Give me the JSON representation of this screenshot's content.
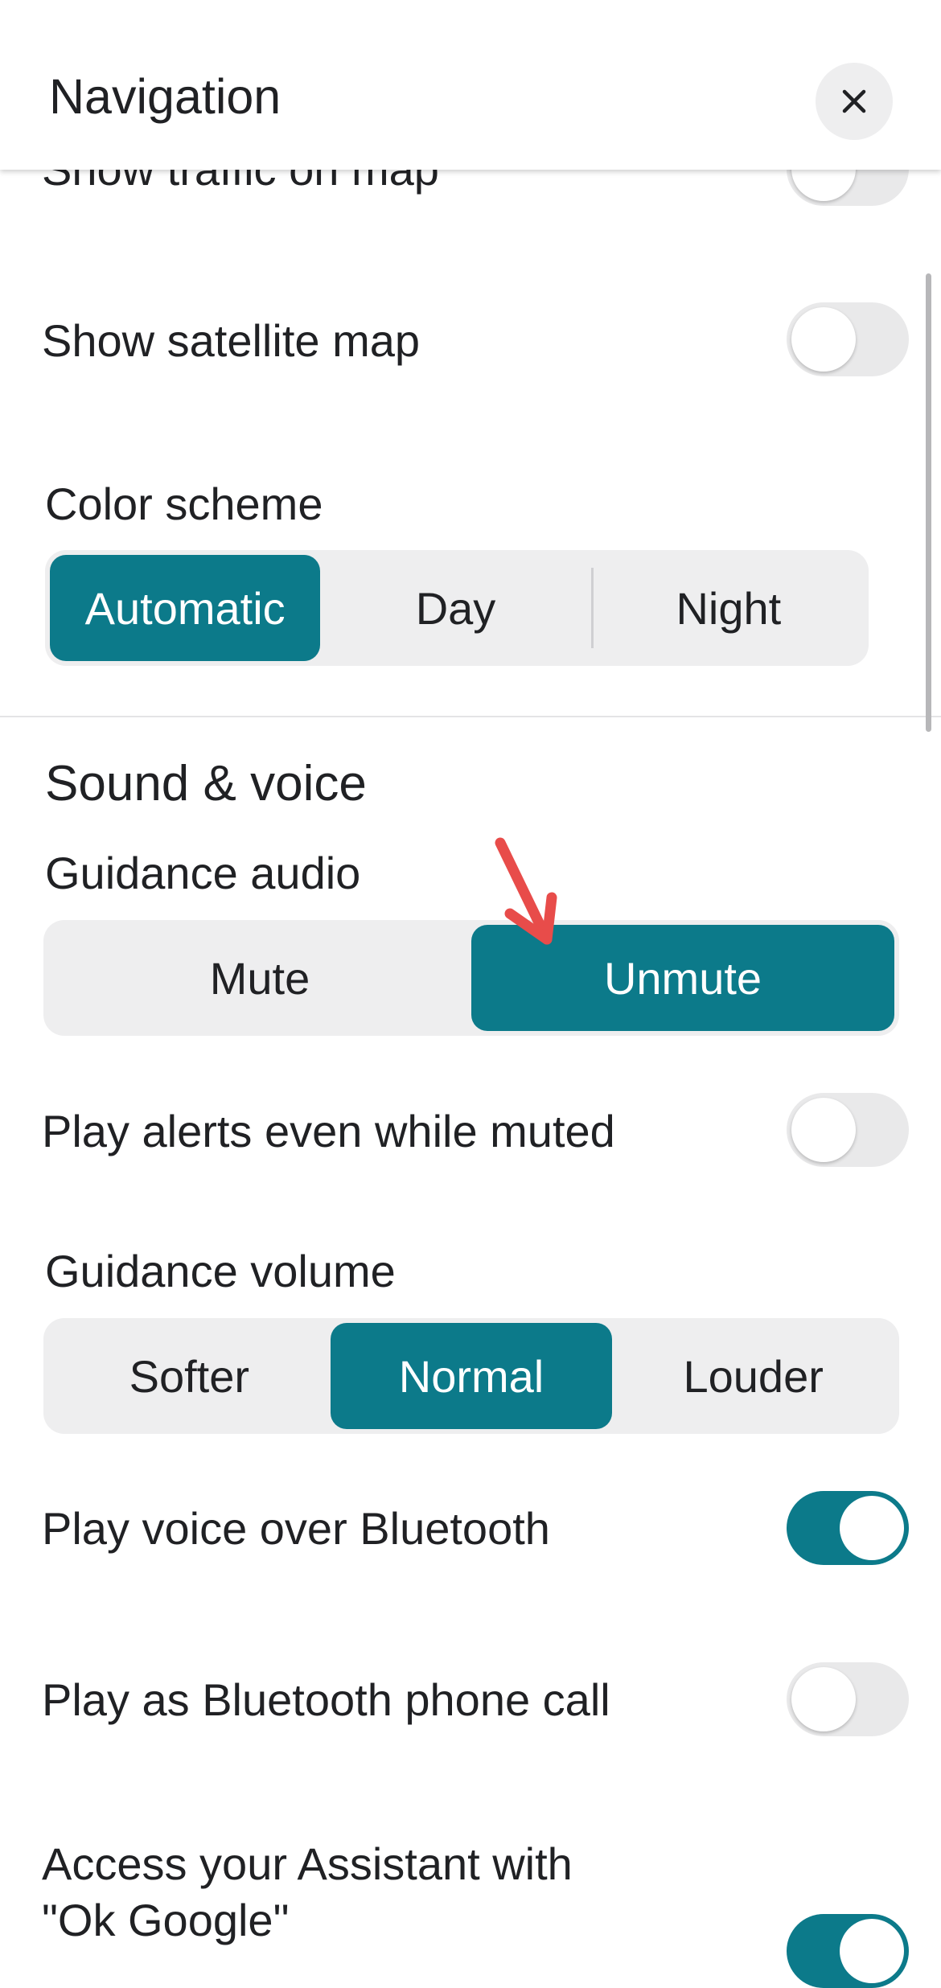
{
  "header": {
    "title": "Navigation",
    "close_icon": "close-icon"
  },
  "settings": {
    "traffic": {
      "label": "Show traffic on map",
      "on": false
    },
    "satellite": {
      "label": "Show satellite map",
      "on": false
    },
    "color_scheme": {
      "label": "Color scheme",
      "options": [
        "Automatic",
        "Day",
        "Night"
      ],
      "selected": "Automatic"
    },
    "sound_section_title": "Sound & voice",
    "guidance_audio": {
      "label": "Guidance audio",
      "options": [
        "Mute",
        "Unmute"
      ],
      "selected": "Unmute"
    },
    "play_alerts": {
      "label": "Play alerts even while muted",
      "on": false
    },
    "guidance_volume": {
      "label": "Guidance volume",
      "options": [
        "Softer",
        "Normal",
        "Louder"
      ],
      "selected": "Normal"
    },
    "voice_bluetooth": {
      "label": "Play voice over Bluetooth",
      "on": true
    },
    "bluetooth_call": {
      "label": "Play as Bluetooth phone call",
      "on": false
    },
    "assistant": {
      "label_line1": "Access your Assistant with",
      "label_line2": "\"Ok Google\"",
      "on": true
    }
  },
  "colors": {
    "accent": "#0c7a8a",
    "segment_bg": "#eeeeef",
    "toggle_off": "#e9e9ea",
    "annotation_arrow": "#e84c4a"
  }
}
